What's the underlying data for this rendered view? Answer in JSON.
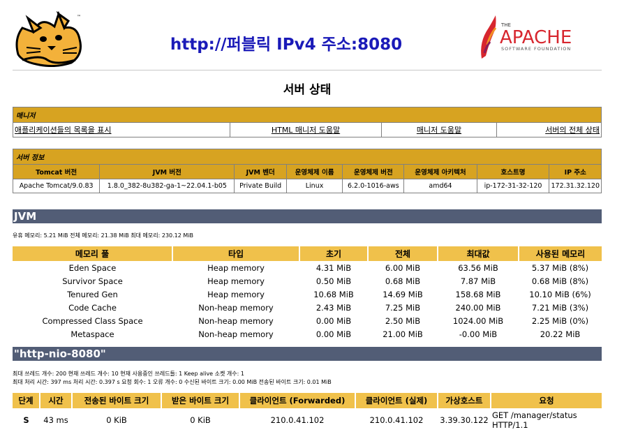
{
  "header": {
    "url_text": "http://퍼블릭 IPv4 주소:8080",
    "page_title": "서버 상태"
  },
  "manager": {
    "title": "매니저",
    "links": [
      "애플리케이션들의 목록을 표시",
      "HTML 매니저 도움말",
      "매니저 도움말",
      "서버의 전체 상태"
    ]
  },
  "server_info": {
    "title": "서버 정보",
    "headers": [
      "Tomcat 버전",
      "JVM 버전",
      "JVM 벤더",
      "운영체제 이름",
      "운영체제 버전",
      "운영체제 아키텍처",
      "호스트명",
      "IP 주소"
    ],
    "values": [
      "Apache Tomcat/9.0.83",
      "1.8.0_382-8u382-ga-1~22.04.1-b05",
      "Private Build",
      "Linux",
      "6.2.0-1016-aws",
      "amd64",
      "ip-172-31-32-120",
      "172.31.32.120"
    ]
  },
  "jvm": {
    "section_title": "JVM",
    "memory_summary": "유휴 메모리: 5.21 MiB 전체 메모리: 21.38 MiB 최대 메모리: 230.12 MiB",
    "headers": [
      "메모리 풀",
      "타입",
      "초기",
      "전체",
      "최대값",
      "사용된 메모리"
    ],
    "rows": [
      [
        "Eden Space",
        "Heap memory",
        "4.31 MiB",
        "6.00 MiB",
        "63.56 MiB",
        "5.37 MiB (8%)"
      ],
      [
        "Survivor Space",
        "Heap memory",
        "0.50 MiB",
        "0.68 MiB",
        "7.87 MiB",
        "0.68 MiB (8%)"
      ],
      [
        "Tenured Gen",
        "Heap memory",
        "10.68 MiB",
        "14.69 MiB",
        "158.68 MiB",
        "10.10 MiB (6%)"
      ],
      [
        "Code Cache",
        "Non-heap memory",
        "2.43 MiB",
        "7.25 MiB",
        "240.00 MiB",
        "7.21 MiB (3%)"
      ],
      [
        "Compressed Class Space",
        "Non-heap memory",
        "0.00 MiB",
        "2.50 MiB",
        "1024.00 MiB",
        "2.25 MiB (0%)"
      ],
      [
        "Metaspace",
        "Non-heap memory",
        "0.00 MiB",
        "21.00 MiB",
        "-0.00 MiB",
        "20.22 MiB"
      ]
    ]
  },
  "connector": {
    "section_title": "\"http-nio-8080\"",
    "line1": "최대 쓰레드 개수: 200 현재 쓰레드 개수: 10 현재 사용중인 쓰레드들: 1 Keep alive 소켓 개수: 1",
    "line2": "최대 처리 시간: 397 ms 처리 시간: 0.397 s 요청 회수: 1 오류 개수: 0 수신된 바이트 크기: 0.00 MiB 전송된 바이트 크기: 0.01 MiB",
    "headers": [
      "단계",
      "시간",
      "전송된 바이트 크기",
      "받은 바이트 크기",
      "클라이언트 (Forwarded)",
      "클라이언트 (실제)",
      "가상호스트",
      "요청"
    ],
    "rows": [
      [
        "S",
        "43 ms",
        "0 KiB",
        "0 KiB",
        "210.0.41.102",
        "210.0.41.102",
        "3.39.30.122",
        "GET /manager/status HTTP/1.1"
      ]
    ]
  },
  "apache_logo": {
    "the": "THE",
    "name": "APACHE",
    "tagline": "SOFTWARE FOUNDATION"
  },
  "colors": {
    "gold": "#d7a321",
    "light_gold": "#f0c14b",
    "section_bar": "#525d76",
    "url_blue": "#1a1ab8"
  }
}
